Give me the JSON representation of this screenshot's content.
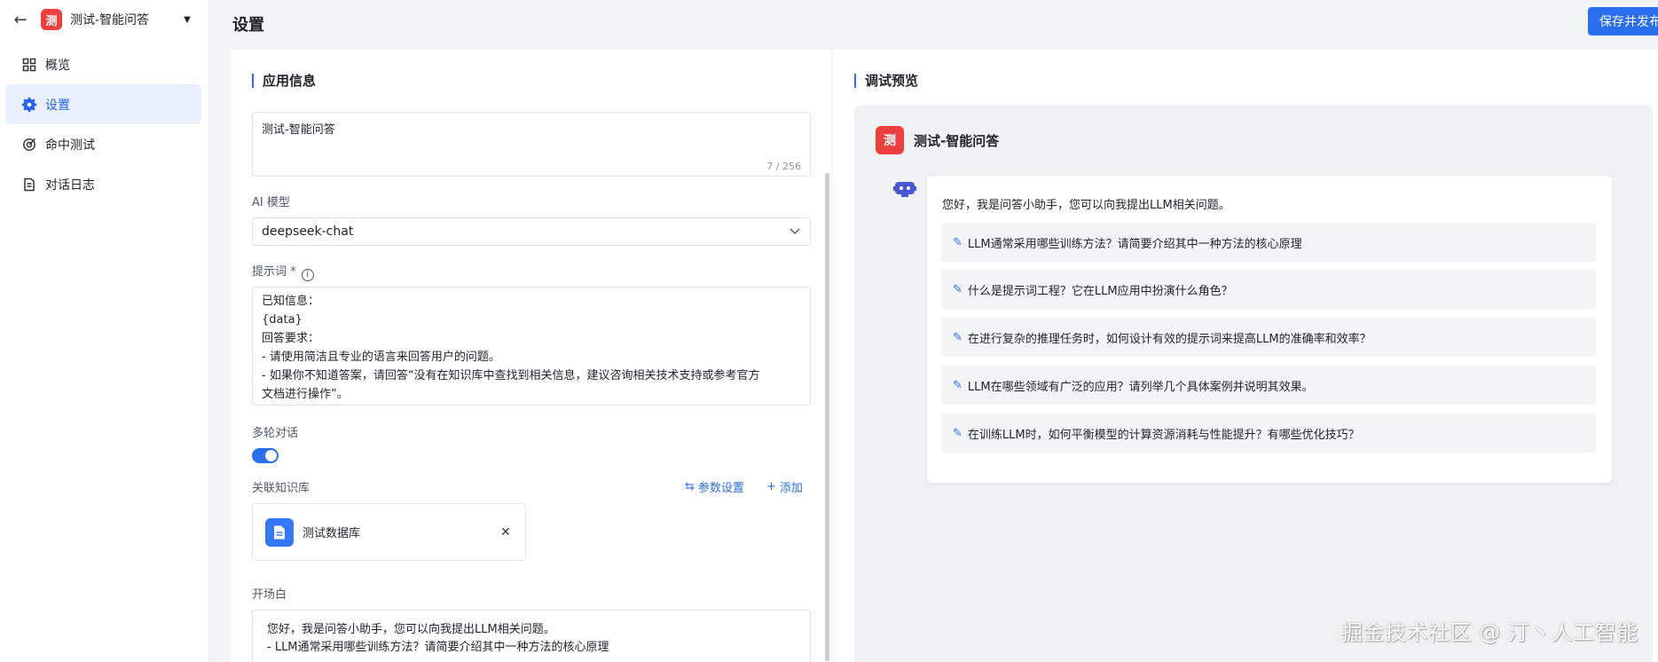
{
  "sidebar": {
    "app_logo": "测",
    "app_name": "测试-智能问答",
    "items": [
      {
        "label": "概览",
        "icon": "grid-icon"
      },
      {
        "label": "设置",
        "icon": "gear-icon"
      },
      {
        "label": "命中测试",
        "icon": "target-icon"
      },
      {
        "label": "对话日志",
        "icon": "document-icon"
      }
    ]
  },
  "header": {
    "title": "设置",
    "publish_label": "保存并发布"
  },
  "app_info": {
    "section_title": "应用信息",
    "name_value": "测试-智能问答",
    "name_counter": "7 / 256",
    "model_label": "AI 模型",
    "model_value": "deepseek-chat",
    "prompt_label": "提示词 *",
    "prompt_lines": [
      "已知信息：",
      "{data}",
      "回答要求：",
      "- 请使用简洁且专业的语言来回答用户的问题。",
      "- 如果你不知道答案，请回答“没有在知识库中查找到相关信息，建议咨询相关技术支持或参考官方",
      "文档进行操作”。"
    ],
    "multi_turn_label": "多轮对话",
    "multi_turn_on": true,
    "kb_label": "关联知识库",
    "kb_params_label": "参数设置",
    "kb_add_label": "添加",
    "kb_item": "测试数据库",
    "opening_label": "开场白",
    "opening_lines": [
      "您好，我是问答小助手，您可以向我提出LLM相关问题。",
      "-  LLM通常采用哪些训练方法？请简要介绍其中一种方法的核心原理"
    ]
  },
  "preview": {
    "section_title": "调试预览",
    "app_logo": "测",
    "app_name": "测试-智能问答",
    "greeting": "您好，我是问答小助手，您可以向我提出LLM相关问题。",
    "questions": [
      "LLM通常采用哪些训练方法？请简要介绍其中一种方法的核心原理",
      "什么是提示词工程？它在LLM应用中扮演什么角色？",
      "在进行复杂的推理任务时，如何设计有效的提示词来提高LLM的准确率和效率？",
      "LLM在哪些领域有广泛的应用？请列举几个具体案例并说明其效果。",
      "在训练LLM时，如何平衡模型的计算资源消耗与性能提升？有哪些优化技巧？"
    ]
  },
  "watermark": "掘金技术社区 @ 汀丶人工智能",
  "colors": {
    "accent": "#2a6ef0",
    "logo": "#ee3f3f",
    "active_bg": "#e8f1fd"
  }
}
